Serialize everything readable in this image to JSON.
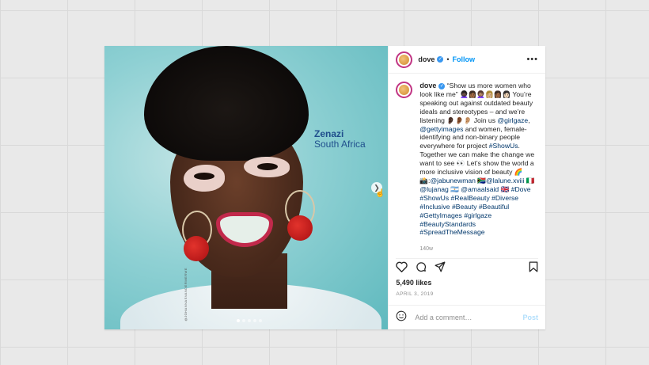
{
  "photo": {
    "name": "Zenazi",
    "place": "South Africa",
    "credit": "@JOHANNASVANDERMERWE",
    "slide_count": 5,
    "active_slide": 1
  },
  "account": {
    "handle": "dove",
    "separator": "•",
    "follow_label": "Follow",
    "more_icon": "more-horizontal-icon"
  },
  "caption": {
    "handle": "dove",
    "segments": [
      {
        "t": "“Show us more women who look like me” 👩🏿‍🦱👩🏾👩🏽‍🦱👩🏼👩🏾👩🏻 You’re speaking out against outdated beauty ideals and stereotypes – and we’re listening 👂🏿👂🏾👂🏼 Join us ",
        "link": false
      },
      {
        "t": "@girlgaze",
        "link": true
      },
      {
        "t": ", ",
        "link": false
      },
      {
        "t": "@gettyimages",
        "link": true
      },
      {
        "t": " and women, female-identifying and non-binary people everywhere for project ",
        "link": false
      },
      {
        "t": "#ShowUs",
        "link": true
      },
      {
        "t": ". Together we can make the change we want to see 👀 Let’s show the world a more inclusive vision of beauty 🌈 📸:",
        "link": false
      },
      {
        "t": "@jabunewman",
        "link": true
      },
      {
        "t": " 🇿🇦",
        "link": false
      },
      {
        "t": "@lalune.xviii",
        "link": true
      },
      {
        "t": " 🇮🇹 ",
        "link": false
      },
      {
        "t": "@lujanag",
        "link": true
      },
      {
        "t": " 🇦🇷 ",
        "link": false
      },
      {
        "t": "@amaalsaid",
        "link": true
      },
      {
        "t": " 🇬🇧 ",
        "link": false
      },
      {
        "t": "#Dove",
        "link": true
      },
      {
        "t": " ",
        "link": false
      },
      {
        "t": "#ShowUs",
        "link": true
      },
      {
        "t": " ",
        "link": false
      },
      {
        "t": "#RealBeauty",
        "link": true
      },
      {
        "t": " ",
        "link": false
      },
      {
        "t": "#Diverse",
        "link": true
      },
      {
        "t": " ",
        "link": false
      },
      {
        "t": "#Inclusive",
        "link": true
      },
      {
        "t": " ",
        "link": false
      },
      {
        "t": "#Beauty",
        "link": true
      },
      {
        "t": " ",
        "link": false
      },
      {
        "t": "#Beautiful",
        "link": true
      },
      {
        "t": " ",
        "link": false
      },
      {
        "t": "#GettyImages",
        "link": true
      },
      {
        "t": " ",
        "link": false
      },
      {
        "t": "#girlgaze",
        "link": true
      },
      {
        "t": " ",
        "link": false
      },
      {
        "t": "#BeautyStandards",
        "link": true
      },
      {
        "t": " ",
        "link": false
      },
      {
        "t": "#SpreadTheMessage",
        "link": true
      }
    ],
    "age": "140w"
  },
  "actions": {
    "like_icon": "heart-icon",
    "comment_icon": "comment-icon",
    "share_icon": "share-icon",
    "save_icon": "bookmark-icon"
  },
  "likes": "5,490 likes",
  "date": "APRIL 3, 2019",
  "comment_box": {
    "emoji_icon": "emoji-icon",
    "placeholder": "Add a comment…",
    "post_label": "Post"
  },
  "colors": {
    "link": "#00376b",
    "follow": "#0095f6",
    "post_disabled": "#b2dffc",
    "verified": "#3897f0"
  }
}
